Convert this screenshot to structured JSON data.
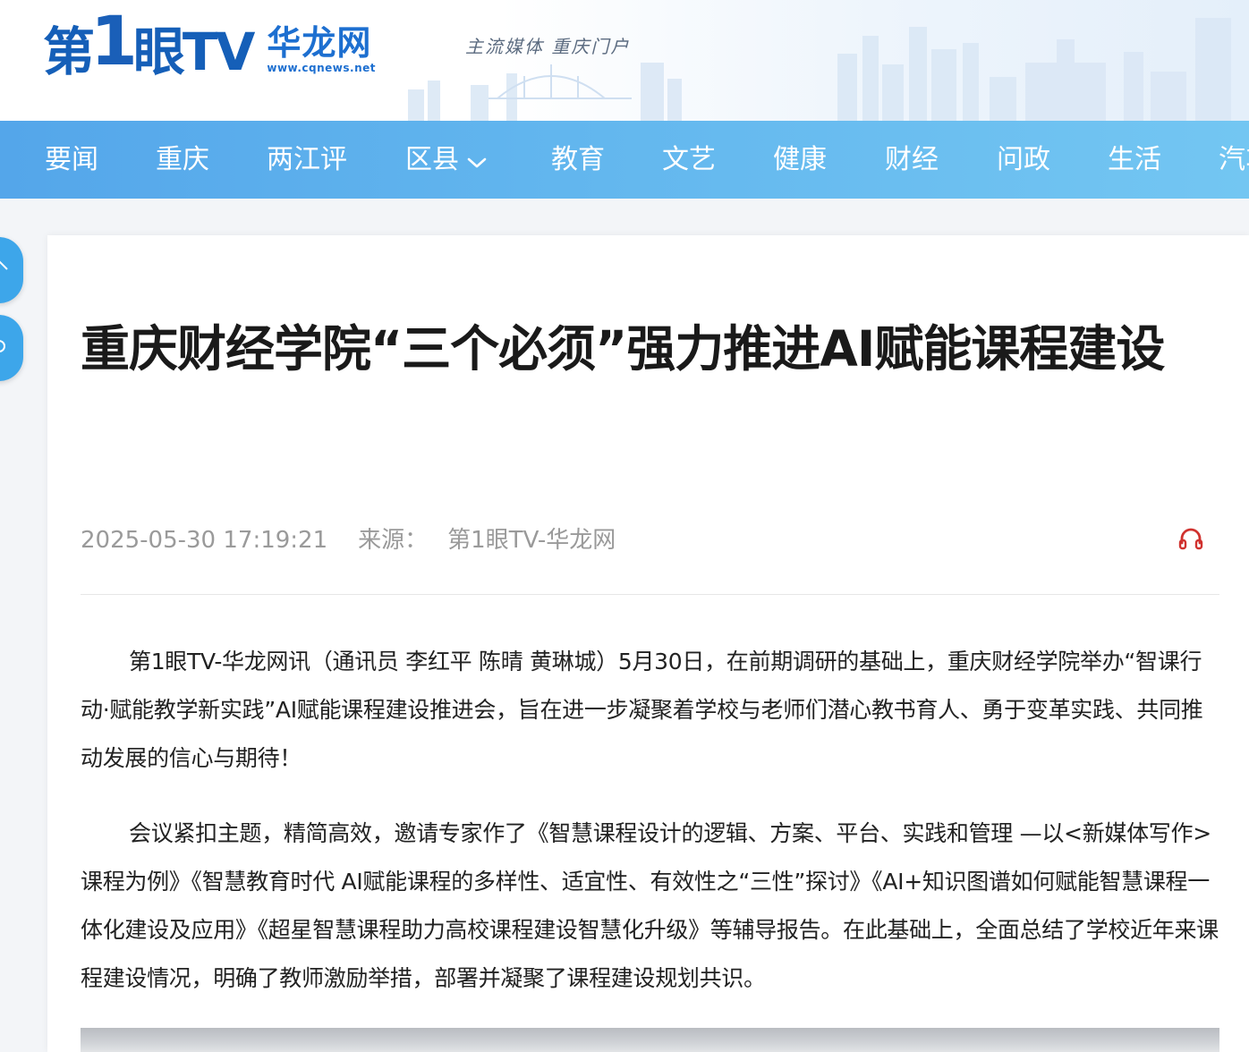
{
  "header": {
    "logo_main_a": "第",
    "logo_main_one": "1",
    "logo_main_b": "眼TV",
    "logo_hualong": "华龙网",
    "logo_url": "www.cqnews.net",
    "slogan": "主流媒体  重庆门户"
  },
  "nav": {
    "items": [
      {
        "label": "要闻"
      },
      {
        "label": "重庆"
      },
      {
        "label": "两江评"
      },
      {
        "label": "区县"
      },
      {
        "label": "教育"
      },
      {
        "label": "文艺"
      },
      {
        "label": "健康"
      },
      {
        "label": "财经"
      },
      {
        "label": "问政"
      },
      {
        "label": "生活"
      },
      {
        "label": "汽车"
      }
    ]
  },
  "article": {
    "title": "重庆财经学院“三个必须”强力推进AI赋能课程建设",
    "date": "2025-05-30 17:19:21",
    "source_label": "来源：",
    "source": "第1眼TV-华龙网",
    "paragraphs": [
      "第1眼TV-华龙网讯（通讯员 李红平 陈晴 黄琳城）5月30日，在前期调研的基础上，重庆财经学院举办“智课行动·赋能教学新实践”AI赋能课程建设推进会，旨在进一步凝聚着学校与老师们潜心教书育人、勇于变革实践、共同推动发展的信心与期待！",
      "会议紧扣主题，精简高效，邀请专家作了《智慧课程设计的逻辑、方案、平台、实践和管理 —以<新媒体写作>课程为例》《智慧教育时代 AI赋能课程的多样性、适宜性、有效性之“三性”探讨》《AI+知识图谱如何赋能智慧课程一体化建设及应用》《超星智慧课程助力高校课程建设智慧化升级》等辅导报告。在此基础上，全面总结了学校近年来课程建设情况，明确了教师激励举措，部署并凝聚了课程建设规划共识。"
    ]
  },
  "colors": {
    "nav_start": "#54a6ea",
    "nav_end": "#73c6f2",
    "brand_blue": "#155fb8",
    "listen_red": "#d0322f"
  }
}
